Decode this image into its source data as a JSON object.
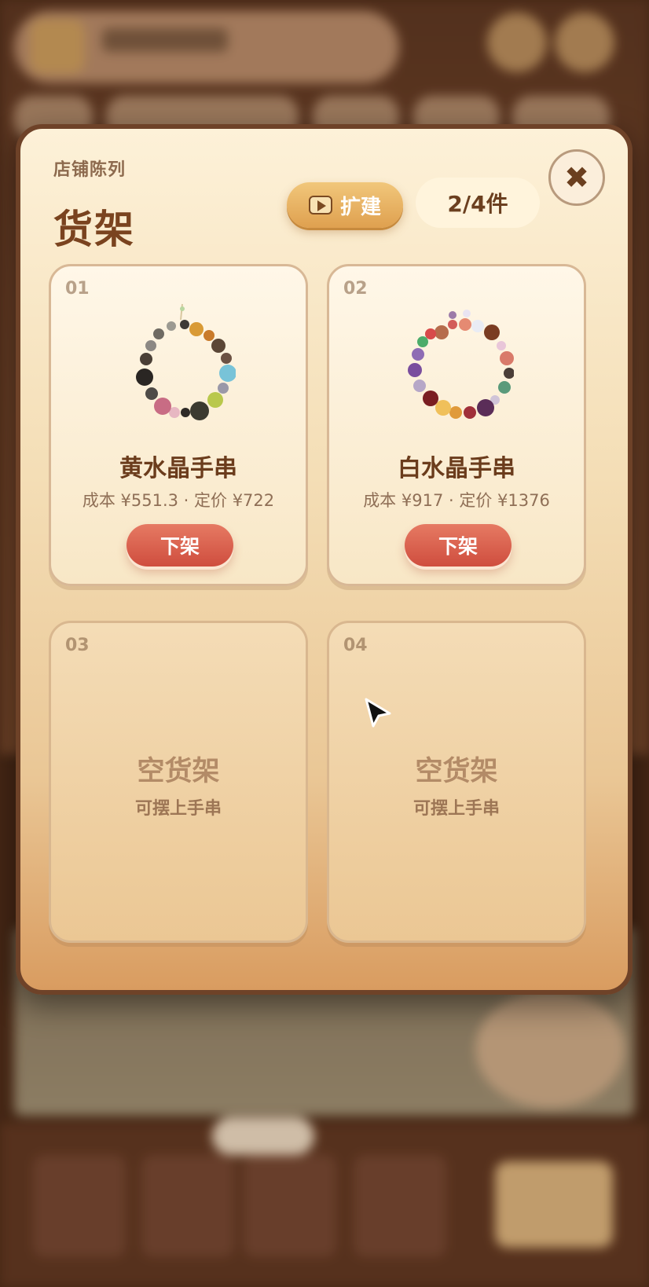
{
  "modal": {
    "subtitle": "店铺陈列",
    "title": "货架",
    "expand_label": "扩建",
    "capacity": "2/4件",
    "close_glyph": "✖"
  },
  "shelves": [
    {
      "slot": "01",
      "name": "黄水晶手串",
      "price": "成本 ¥551.3 · 定价 ¥722",
      "action": "下架"
    },
    {
      "slot": "02",
      "name": "白水晶手串",
      "price": "成本 ¥917 · 定价 ¥1376",
      "action": "下架"
    },
    {
      "slot": "03",
      "empty_title": "空货架",
      "empty_hint": "可摆上手串"
    },
    {
      "slot": "04",
      "empty_title": "空货架",
      "empty_hint": "可摆上手串"
    }
  ],
  "colors": {
    "primary_text": "#6b3c1c",
    "remove_button": "#cf4d3e",
    "expand_button": "#dfa04f",
    "modal_border": "#6e4228"
  },
  "icons": {
    "expand": "play-video-icon",
    "close": "close-icon",
    "pointer": "mouse-cursor-icon"
  }
}
